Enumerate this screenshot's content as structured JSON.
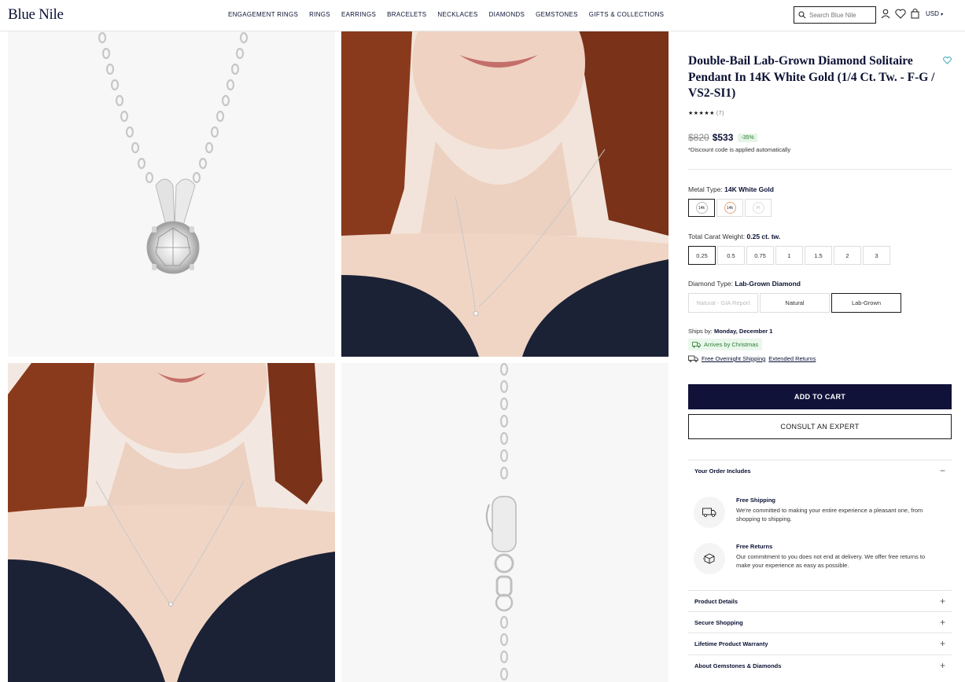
{
  "header": {
    "logo": "Blue Nile",
    "nav": [
      "ENGAGEMENT RINGS",
      "RINGS",
      "EARRINGS",
      "BRACELETS",
      "NECKLACES",
      "DIAMONDS",
      "GEMSTONES",
      "GIFTS & COLLECTIONS"
    ],
    "search_placeholder": "Search Blue Nile",
    "currency": "USD"
  },
  "product": {
    "title": "Double-Bail Lab-Grown Diamond Solitaire Pendant In 14K White Gold (1/4 Ct. Tw. - F-G / VS2-SI1)",
    "stars": "★★★★★",
    "review_count": "(7)",
    "old_price": "$820",
    "new_price": "$533",
    "discount": "-35%",
    "discount_note": "*Discount code is applied automatically"
  },
  "options": {
    "metal_label": "Metal Type:",
    "metal_value": "14K White Gold",
    "metals": [
      {
        "label": "14k",
        "color": "#c9c9c9"
      },
      {
        "label": "14k",
        "color": "#e3a57e"
      },
      {
        "label": "Pt",
        "color": "#e0e0e0"
      }
    ],
    "carat_label": "Total Carat Weight:",
    "carat_value": "0.25 ct. tw.",
    "carats": [
      "0.25",
      "0.5",
      "0.75",
      "1",
      "1.5",
      "2",
      "3"
    ],
    "diamond_label": "Diamond Type:",
    "diamond_value": "Lab-Grown Diamond",
    "diamond_types": [
      "Natural - GIA Report",
      "Natural",
      "Lab-Grown"
    ]
  },
  "shipping": {
    "ships_by_label": "Ships by:",
    "ships_by_value": "Monday, December 1",
    "christmas": "Arrives by Christmas",
    "free_overnight": "Free Overnight Shipping",
    "extended_returns": "Extended Returns"
  },
  "buttons": {
    "add_to_cart": "ADD TO CART",
    "consult": "CONSULT AN EXPERT"
  },
  "order_includes": {
    "title": "Your Order Includes",
    "items": [
      {
        "title": "Free Shipping",
        "desc": "We're committed to making your entire experience a pleasant one, from shopping to shipping."
      },
      {
        "title": "Free Returns",
        "desc": "Our commitment to you does not end at delivery. We offer free returns to make your experience as easy as possible."
      }
    ]
  },
  "accordions": [
    "Product Details",
    "Secure Shopping",
    "Lifetime Product Warranty",
    "About Gemstones & Diamonds"
  ],
  "colors": {
    "brand_navy": "#11123a",
    "sale_green": "#2e7d32",
    "fav_teal": "#3aa6b9"
  }
}
